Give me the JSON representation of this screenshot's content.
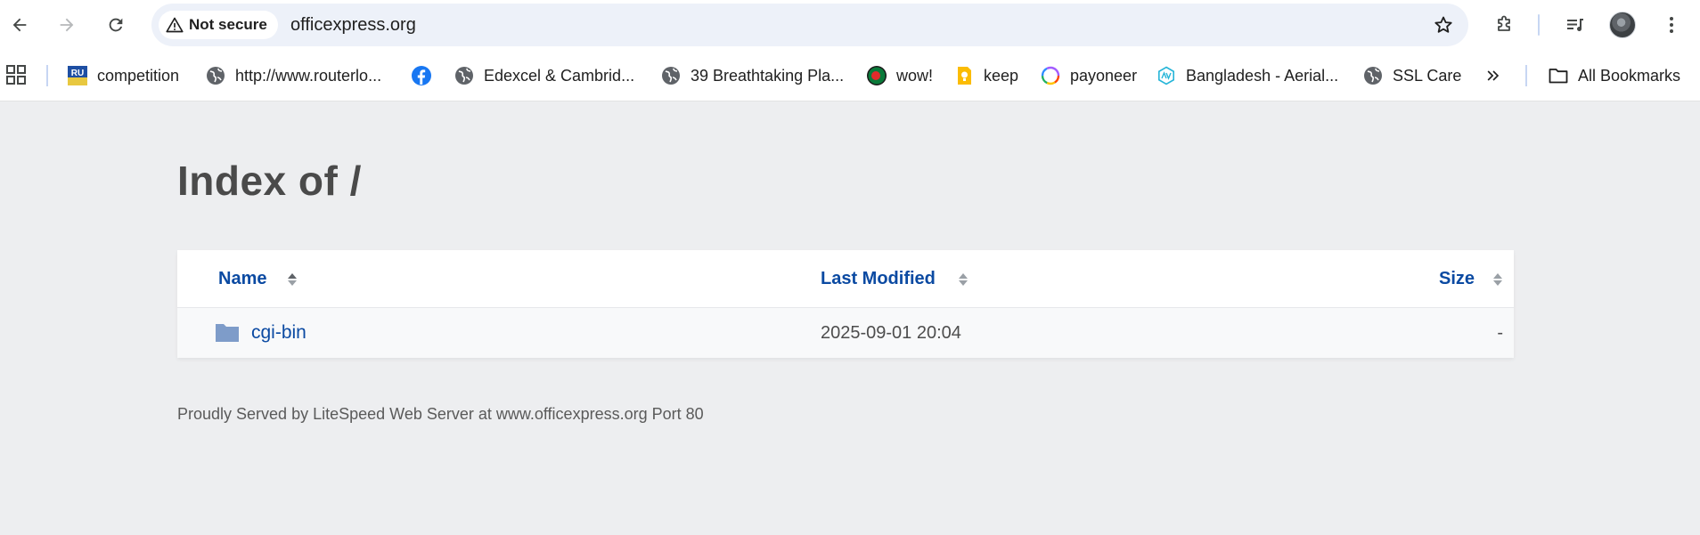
{
  "toolbar": {
    "security_label": "Not secure",
    "url": "officexpress.org",
    "icons": [
      "back-icon",
      "forward-icon",
      "reload-icon",
      "warning-icon",
      "star-icon",
      "extensions-icon",
      "media-control-icon",
      "avatar",
      "menu-icon"
    ]
  },
  "bookmarks": {
    "items": [
      {
        "label": "competition",
        "icon": "ru-favicon"
      },
      {
        "label": "http://www.routerlo...",
        "icon": "globe-icon"
      },
      {
        "label": "",
        "icon": "facebook-icon"
      },
      {
        "label": "Edexcel & Cambrid...",
        "icon": "globe-icon"
      },
      {
        "label": "39 Breathtaking Pla...",
        "icon": "globe-icon"
      },
      {
        "label": "wow!",
        "icon": "bangladesh-flag-icon"
      },
      {
        "label": "keep",
        "icon": "keep-icon"
      },
      {
        "label": "payoneer",
        "icon": "payoneer-icon"
      },
      {
        "label": "Bangladesh - Aerial...",
        "icon": "aerial-icon"
      },
      {
        "label": "SSL Care",
        "icon": "globe-icon"
      }
    ],
    "all_bookmarks": "All Bookmarks"
  },
  "page": {
    "title": "Index of /",
    "columns": {
      "name": "Name",
      "modified": "Last Modified",
      "size": "Size"
    },
    "rows": [
      {
        "name": "cgi-bin",
        "modified": "2025-09-01 20:04",
        "size": "-"
      }
    ],
    "footer": "Proudly Served by LiteSpeed Web Server at www.officexpress.org Port 80"
  },
  "colors": {
    "link": "#0b4aa2",
    "page_bg": "#edeef0",
    "folder": "#7e9cc9",
    "omnibox_bg": "#edf1f9"
  }
}
